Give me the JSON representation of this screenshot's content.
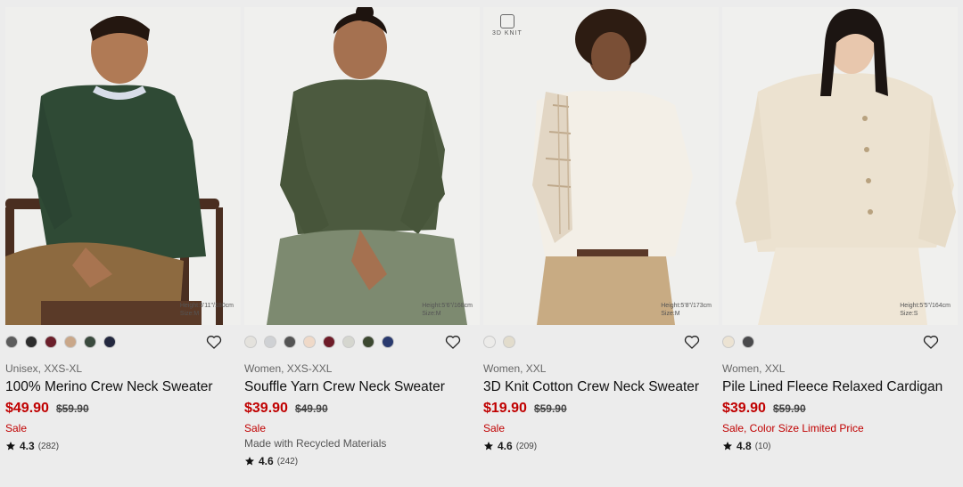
{
  "products": [
    {
      "colors": [
        "#5c5c5c",
        "#2c2c2c",
        "#6b1f2a",
        "#c9a789",
        "#3a4a3e",
        "#23283f"
      ],
      "meta": "Unisex, XXS-XL",
      "title": "100% Merino Crew Neck Sweater",
      "price": "$49.90",
      "original_price": "$59.90",
      "sale_label": "Sale",
      "note": "",
      "rating": "4.3",
      "reviews": "(282)",
      "badge": "",
      "height_info": [
        "Height:5'11\"/180cm",
        "Size:M"
      ]
    },
    {
      "colors": [
        "#e4e2dd",
        "#cfd1d4",
        "#545454",
        "#efd9c8",
        "#6e1c28",
        "#d5d6cf",
        "#3c4830",
        "#2a3a6e"
      ],
      "meta": "Women, XXS-XXL",
      "title": "Souffle Yarn Crew Neck Sweater",
      "price": "$39.90",
      "original_price": "$49.90",
      "sale_label": "Sale",
      "note": "Made with Recycled Materials",
      "rating": "4.6",
      "reviews": "(242)",
      "badge": "",
      "height_info": [
        "Height:5'6\"/168cm",
        "Size:M"
      ]
    },
    {
      "colors": [
        "#ecebe9",
        "#e2dccc"
      ],
      "meta": "Women, XXL",
      "title": "3D Knit Cotton Crew Neck Sweater",
      "price": "$19.90",
      "original_price": "$59.90",
      "sale_label": "Sale",
      "note": "",
      "rating": "4.6",
      "reviews": "(209)",
      "badge": "3D KNIT",
      "height_info": [
        "Height:5'8\"/173cm",
        "Size:M"
      ]
    },
    {
      "colors": [
        "#ece3d3",
        "#4a4a4c"
      ],
      "meta": "Women, XXL",
      "title": "Pile Lined Fleece Relaxed Cardigan",
      "price": "$39.90",
      "original_price": "$59.90",
      "sale_label": "Sale, Color Size Limited Price",
      "note": "",
      "rating": "4.8",
      "reviews": "(10)",
      "badge": "",
      "height_info": [
        "Height:5'5\"/164cm",
        "Size:S"
      ]
    }
  ],
  "accent": "#c00000",
  "icons": {
    "wishlist": "heart-outline-icon",
    "rating": "star-icon",
    "badge": "3d-knit-icon"
  }
}
